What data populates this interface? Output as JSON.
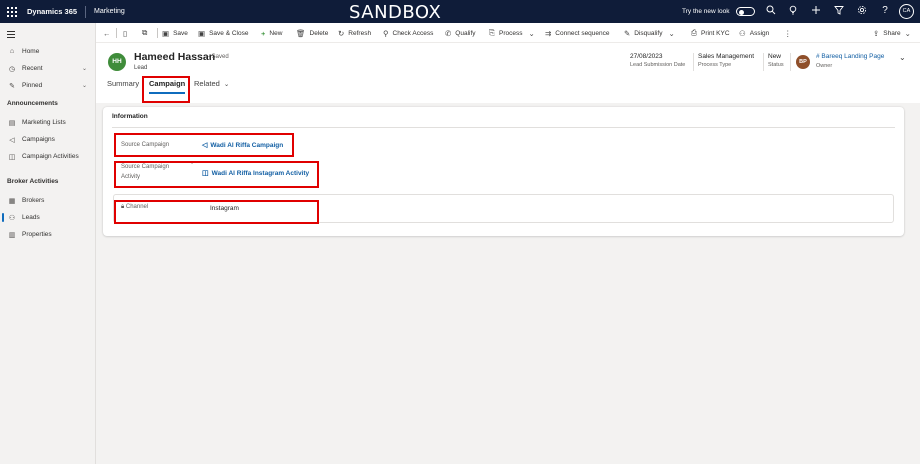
{
  "topbar": {
    "app_name": "Dynamics 365",
    "module": "Marketing",
    "environment": "SANDBOX",
    "try_new_look": "Try the new look",
    "user_initials": "CA",
    "bg_color": "#0f1c39"
  },
  "leftnav": {
    "items_top": [
      {
        "label": "Home",
        "icon": "home-icon"
      },
      {
        "label": "Recent",
        "icon": "clock-icon"
      },
      {
        "label": "Pinned",
        "icon": "pin-icon"
      }
    ],
    "group_announcements": "Announcements",
    "items_announcements": [
      {
        "label": "Marketing Lists",
        "icon": "list-icon"
      },
      {
        "label": "Campaigns",
        "icon": "megaphone-icon"
      },
      {
        "label": "Campaign Activities",
        "icon": "campaign-activity-icon"
      }
    ],
    "group_broker": "Broker Activities",
    "items_broker": [
      {
        "label": "Brokers",
        "icon": "people-icon"
      },
      {
        "label": "Leads",
        "icon": "lead-icon"
      },
      {
        "label": "Properties",
        "icon": "property-icon"
      }
    ],
    "active_item": "Leads"
  },
  "commandbar": {
    "save": "Save",
    "save_close": "Save & Close",
    "new": "New",
    "delete": "Delete",
    "refresh": "Refresh",
    "check_access": "Check Access",
    "qualify": "Qualify",
    "process": "Process",
    "connect_sequence": "Connect sequence",
    "disqualify": "Disqualify",
    "print_kyc": "Print KYC",
    "assign": "Assign",
    "share": "Share"
  },
  "record": {
    "initials": "HH",
    "name": "Hameed Hassan",
    "saved_status": "- Saved",
    "entity": "Lead",
    "avatar_color": "#3f8c3a",
    "header_fields": [
      {
        "value": "27/08/2023",
        "label": "Lead Submission Date"
      },
      {
        "value": "Sales Management",
        "label": "Process Type"
      },
      {
        "value": "New",
        "label": "Status"
      }
    ],
    "owner": {
      "initials": "BP",
      "name": "# Bareeq Landing Page",
      "label": "Owner"
    }
  },
  "tabs": [
    {
      "label": "Summary",
      "selected": false
    },
    {
      "label": "Campaign",
      "selected": true
    },
    {
      "label": "Related",
      "selected": false
    }
  ],
  "section": {
    "title": "Information",
    "fields": {
      "source_campaign": {
        "label": "Source Campaign",
        "value": "Wadi Al Riffa Campaign"
      },
      "source_campaign_activity": {
        "label_line1": "Source Campaign",
        "label_line2": "Activity",
        "value": "Wadi Al Riffa Instagram Activity"
      },
      "channel": {
        "label": "Channel",
        "value": "Instagram"
      }
    }
  },
  "highlight_color": "#e00000"
}
